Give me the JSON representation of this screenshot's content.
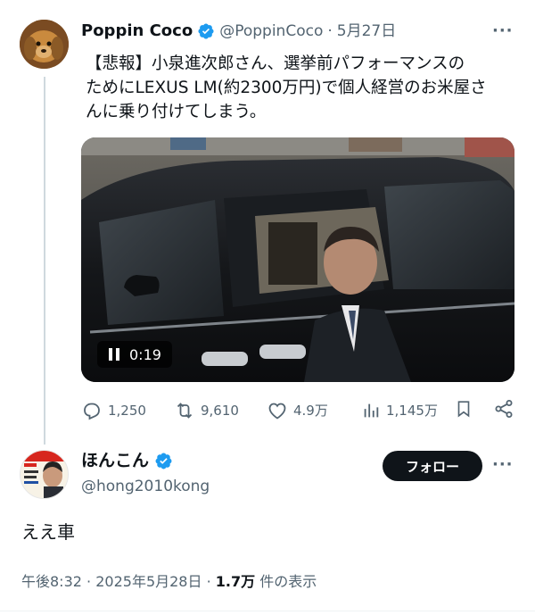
{
  "tweet": {
    "author_name": "Poppin Coco",
    "handle": "@PoppinCoco",
    "separator": "·",
    "date": "5月27日",
    "more_label": "···",
    "text_lines": [
      "【悲報】小泉進次郎さん、選挙前パフォーマンスの",
      "ためにLEXUS LM(約2300万円)で個人経営のお米屋さ",
      "んに乗り付けてしまう。"
    ],
    "video": {
      "time": "0:19",
      "state": "playing"
    },
    "stats": {
      "replies": "1,250",
      "retweets": "9,610",
      "likes": "4.9万",
      "views": "1,145万"
    }
  },
  "reply": {
    "author_name": "ほんこん",
    "handle": "@hong2010kong",
    "follow_label": "フォロー",
    "more_label": "···",
    "text": "ええ車",
    "meta": {
      "time": "午後8:32",
      "sep1": "·",
      "date": "2025年5月28日",
      "sep2": "·",
      "views_count": "1.7万",
      "views_label": "件の表示"
    }
  },
  "colors": {
    "verified": "#1d9bf0",
    "muted": "#536471",
    "text": "#0f1419"
  },
  "icons": [
    "verified-badge-icon",
    "reply-icon",
    "retweet-icon",
    "like-icon",
    "views-icon",
    "bookmark-icon",
    "share-icon",
    "pause-icon"
  ]
}
